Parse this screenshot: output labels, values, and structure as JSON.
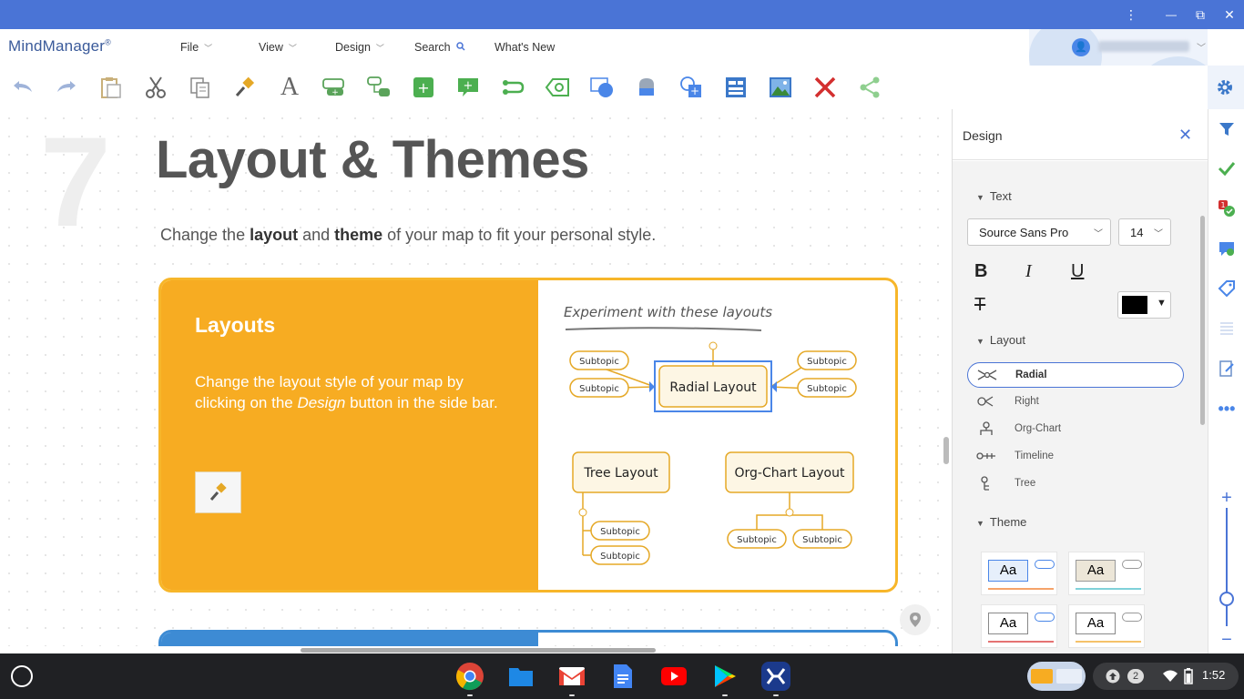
{
  "app": {
    "logo": "MindManager",
    "logo_mark": "®"
  },
  "menu": [
    {
      "label": "File"
    },
    {
      "label": "View"
    },
    {
      "label": "Design"
    },
    {
      "label": "Search"
    },
    {
      "label": "What's New"
    }
  ],
  "window_controls": {
    "more": "⋮",
    "minimize": "—",
    "maximize": "⧉",
    "close": "✕"
  },
  "toolbar": {
    "tools": [
      "undo-icon",
      "redo-icon",
      "paste-icon",
      "cut-icon",
      "copy-icon",
      "format-painter-icon",
      "text-icon",
      "add-topic-icon",
      "add-subtopic-icon",
      "add-floating-topic-icon",
      "callout-icon",
      "relationship-icon",
      "boundary-icon",
      "shape-icon",
      "fill-icon",
      "insert-shape-icon",
      "layout-icon",
      "image-icon",
      "delete-icon",
      "share-icon"
    ]
  },
  "slide": {
    "number": "7",
    "title": "Layout & Themes",
    "subtitle_pre": "Change the ",
    "subtitle_b1": "layout",
    "subtitle_mid": " and ",
    "subtitle_b2": "theme",
    "subtitle_post": " of your map to fit your personal style.",
    "card": {
      "title": "Layouts",
      "body_pre": "Change the layout style of your map by clicking on the ",
      "body_em": "Design",
      "body_post": " button in the side bar.",
      "handwritten": "Experiment with these layouts",
      "radial": "Radial Layout",
      "tree": "Tree Layout",
      "org": "Org-Chart Layout",
      "subtopic": "Subtopic"
    }
  },
  "panel": {
    "title": "Design",
    "text_section": "Text",
    "font": "Source Sans Pro",
    "size": "14",
    "bold": "B",
    "italic": "I",
    "underline": "U",
    "strike": "T",
    "font_color": "#000000",
    "layout_section": "Layout",
    "layouts": [
      {
        "label": "Radial",
        "active": true
      },
      {
        "label": "Right",
        "active": false
      },
      {
        "label": "Org-Chart",
        "active": false
      },
      {
        "label": "Timeline",
        "active": false
      },
      {
        "label": "Tree",
        "active": false
      }
    ],
    "theme_section": "Theme",
    "theme_sample": "Aa"
  },
  "zoom": {
    "plus": "+",
    "minus": "−",
    "level": 0.7
  },
  "shelf": {
    "apps": [
      "chrome-icon",
      "files-icon",
      "gmail-icon",
      "docs-icon",
      "youtube-icon",
      "play-store-icon",
      "mindmanager-icon"
    ],
    "notifications": "2",
    "time": "1:52"
  },
  "colors": {
    "accent": "#4a74d6",
    "orange": "#f7ac22",
    "blue": "#3d8bd4"
  }
}
